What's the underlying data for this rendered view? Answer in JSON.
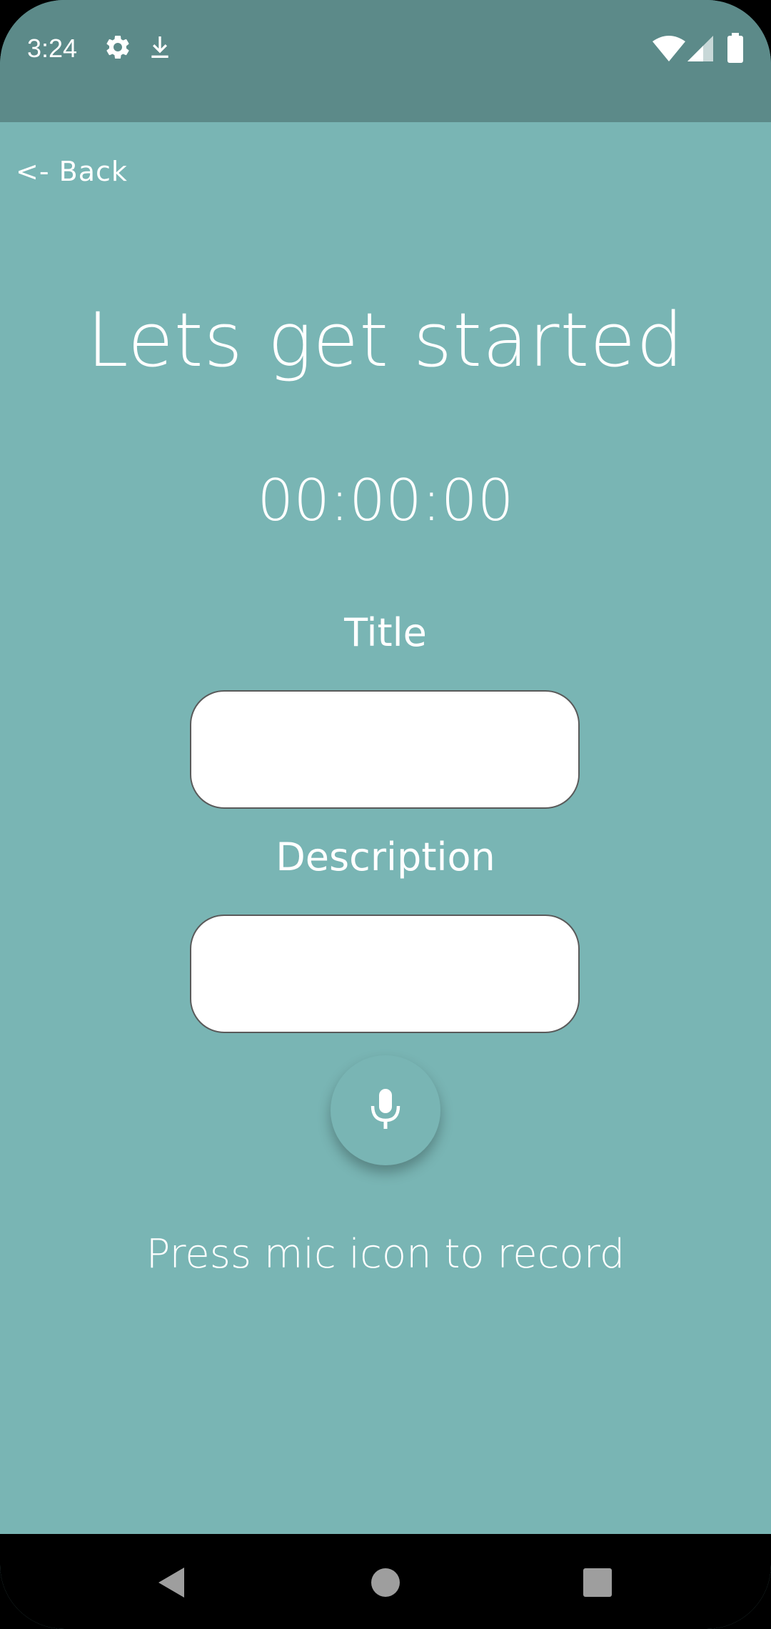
{
  "status_bar": {
    "time": "3:24",
    "icons": [
      "gear-icon",
      "download-icon",
      "wifi-icon",
      "signal-icon",
      "battery-icon"
    ]
  },
  "header": {
    "back_label": "<- Back"
  },
  "main": {
    "title": "Lets get started",
    "timer": "00:00:00",
    "title_field": {
      "label": "Title",
      "value": ""
    },
    "description_field": {
      "label": "Description",
      "value": ""
    },
    "mic_icon": "mic-icon",
    "hint": "Press mic icon to record"
  },
  "nav_bar": {
    "icons": [
      "back-triangle-icon",
      "home-circle-icon",
      "recents-square-icon"
    ]
  },
  "colors": {
    "status_bar": "#5c8a89",
    "background": "#79b5b4",
    "text": "#ffffff",
    "field_bg": "#ffffff",
    "field_border": "#5a5a5a",
    "nav_bar": "#000000"
  }
}
